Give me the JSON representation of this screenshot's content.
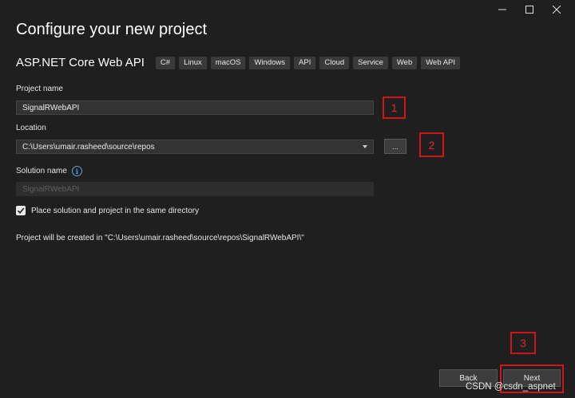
{
  "window": {
    "minimize_glyph": "—",
    "maximize_glyph": "☐",
    "close_glyph": "✕"
  },
  "header": {
    "title": "Configure your new project",
    "template_name": "ASP.NET Core Web API",
    "tags": [
      "C#",
      "Linux",
      "macOS",
      "Windows",
      "API",
      "Cloud",
      "Service",
      "Web",
      "Web API"
    ]
  },
  "form": {
    "project_name_label": "Project name",
    "project_name_value": "SignalRWebAPI",
    "location_label": "Location",
    "location_value": "C:\\Users\\umair.rasheed\\source\\repos",
    "browse_label": "...",
    "solution_name_label": "Solution name",
    "solution_name_value": "SignalRWebAPI",
    "info_glyph": "i",
    "same_dir_label": "Place solution and project in the same directory",
    "same_dir_checked": true,
    "path_note": "Project will be created in \"C:\\Users\\umair.rasheed\\source\\repos\\SignalRWebAPI\\\""
  },
  "annotations": [
    "1",
    "2",
    "3"
  ],
  "buttons": {
    "back_label": "Back",
    "next_label": "Next"
  },
  "watermark": "CSDN @csdn_aspnet",
  "colors": {
    "background": "#1f1f1f",
    "annotation_red": "#d0141a",
    "info_blue": "#5aa5e6"
  }
}
